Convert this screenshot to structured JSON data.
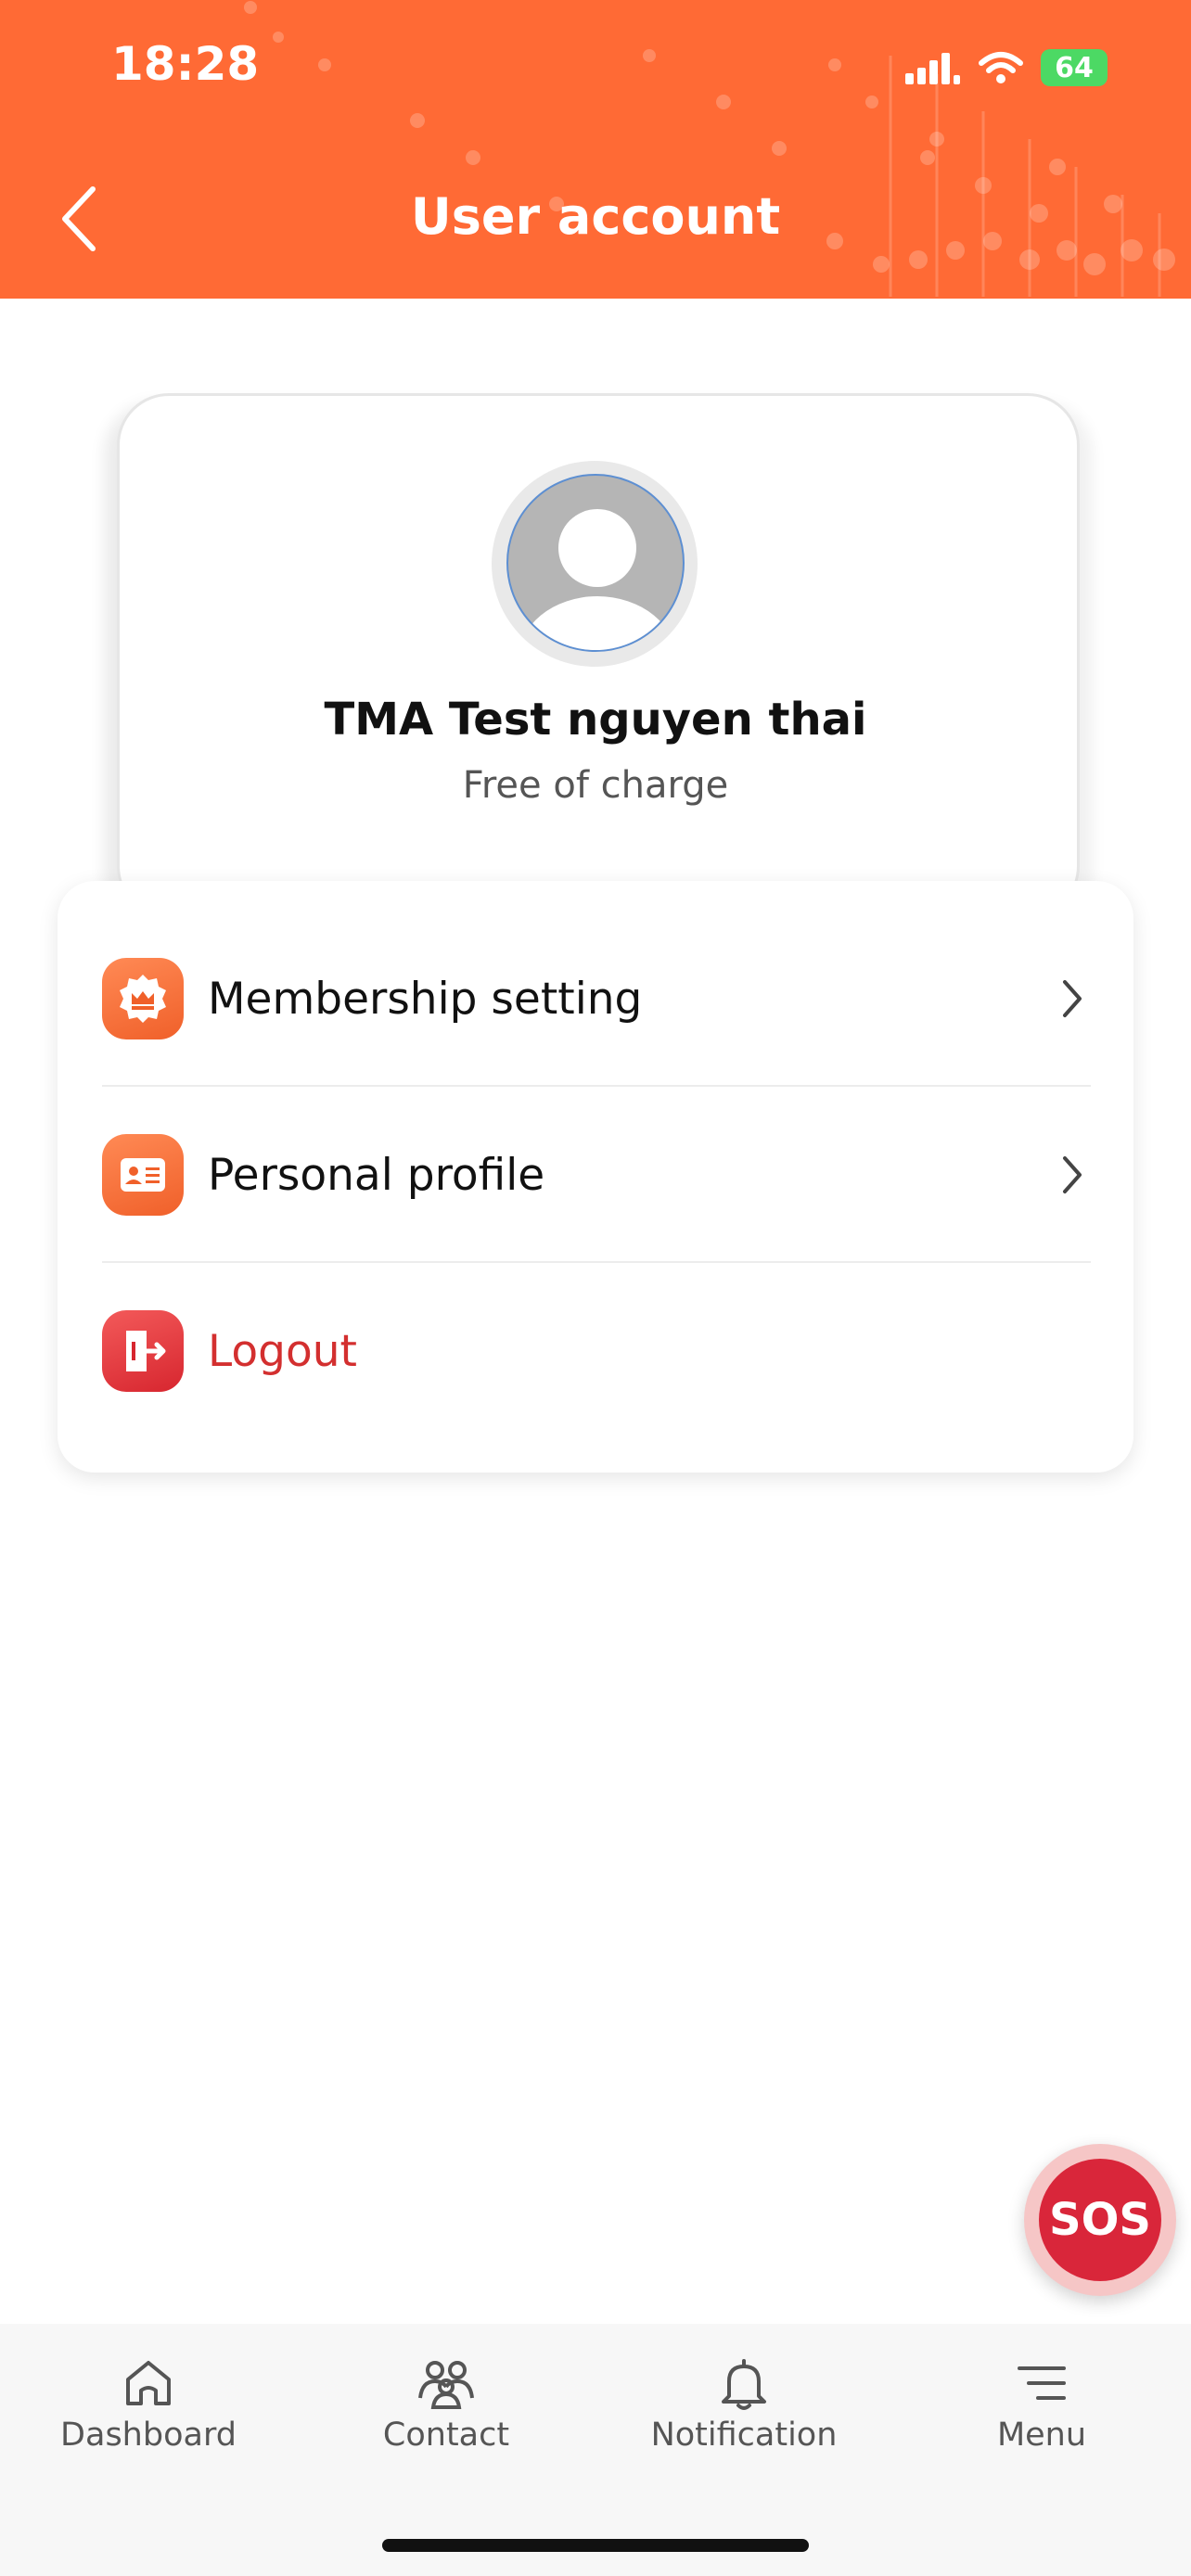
{
  "status_bar": {
    "time": "18:28",
    "battery": "64"
  },
  "header": {
    "title": "User account"
  },
  "profile": {
    "name": "TMA Test nguyen thai",
    "plan": "Free of charge"
  },
  "menu": {
    "items": [
      {
        "label": "Membership setting",
        "icon": "crown-badge-icon"
      },
      {
        "label": "Personal profile",
        "icon": "id-card-icon"
      },
      {
        "label": "Logout",
        "icon": "logout-door-icon"
      }
    ]
  },
  "sos": {
    "label": "SOS"
  },
  "tabs": [
    {
      "label": "Dashboard",
      "icon": "home-icon"
    },
    {
      "label": "Contact",
      "icon": "people-icon"
    },
    {
      "label": "Notification",
      "icon": "bell-icon"
    },
    {
      "label": "Menu",
      "icon": "hamburger-menu-icon"
    }
  ],
  "colors": {
    "accent": "#ff6a35",
    "danger": "#d32f2f",
    "sos": "#d9263a"
  }
}
